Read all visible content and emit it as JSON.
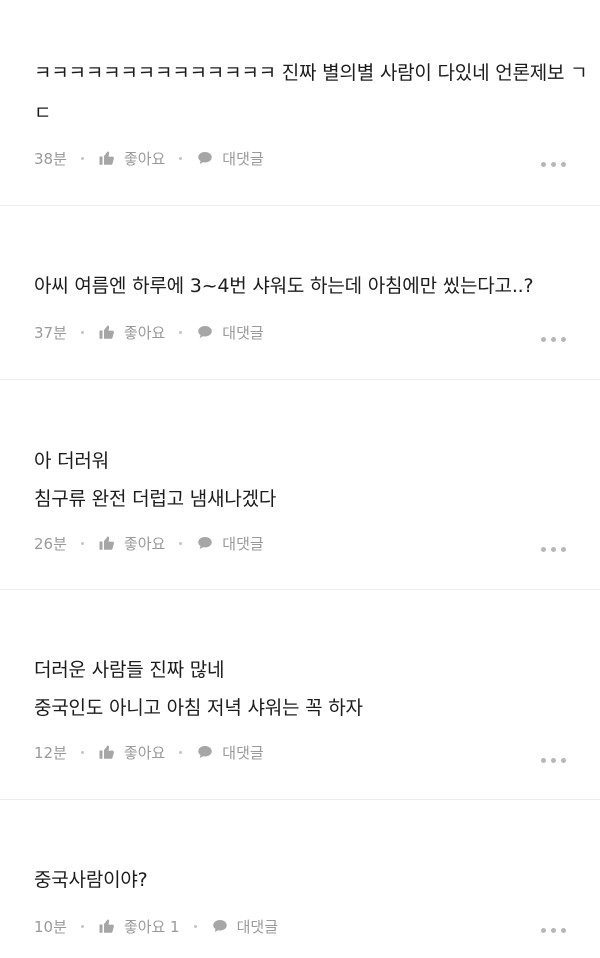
{
  "comments": [
    {
      "lines": [
        "ㅋㅋㅋㅋㅋㅋㅋㅋㅋㅋㅋㅋㅋㅋ 진짜 별의별 사람이 다있네 언론제보 ㄱ",
        "ㄷ"
      ],
      "time": "38분",
      "like_label": "좋아요",
      "reply_label": "대댓글"
    },
    {
      "lines": [
        "아씨 여름엔 하루에 3~4번 샤워도 하는데 아침에만 씼는다고..?"
      ],
      "time": "37분",
      "like_label": "좋아요",
      "reply_label": "대댓글"
    },
    {
      "lines": [
        "아 더러워",
        "침구류 완전 더럽고 냄새나겠다"
      ],
      "time": "26분",
      "like_label": "좋아요",
      "reply_label": "대댓글"
    },
    {
      "lines": [
        "더러운 사람들 진짜 많네",
        "중국인도 아니고 아침 저녁 샤워는 꼭 하자"
      ],
      "time": "12분",
      "like_label": "좋아요",
      "reply_label": "대댓글"
    },
    {
      "lines": [
        "중국사람이야?"
      ],
      "time": "10분",
      "like_label": "좋아요 1",
      "reply_label": "대댓글"
    }
  ],
  "icons": {
    "like": "thumbs-up-icon",
    "reply": "speech-bubble-icon",
    "more": "more-dots-icon"
  },
  "colors": {
    "text": "#1c1c1c",
    "meta": "#9a9a9a",
    "divider": "#ececec"
  }
}
